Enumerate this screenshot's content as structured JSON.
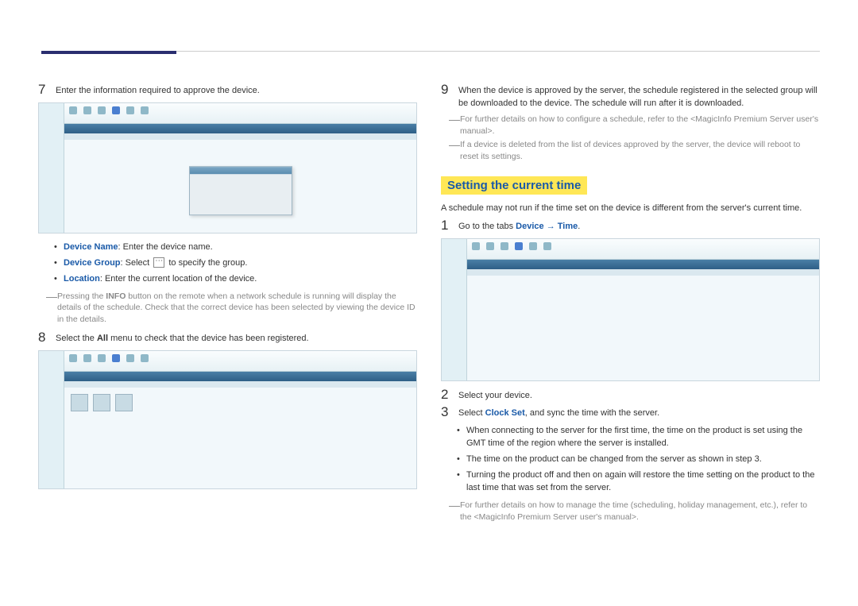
{
  "leftColumn": {
    "step7": {
      "num": "7",
      "text": "Enter the information required to approve the device."
    },
    "bullets7": {
      "deviceNameLabel": "Device Name",
      "deviceNameText": ": Enter the device name.",
      "deviceGroupLabel": "Device Group",
      "deviceGroupPre": ": Select ",
      "deviceGroupPost": " to specify the group.",
      "locationLabel": "Location",
      "locationText": ": Enter the current location of the device."
    },
    "note7": "Pressing the INFO button on the remote when a network schedule is running will display the details of the schedule. Check that the correct device has been selected by viewing the device ID in the details.",
    "note7_boldWord": "INFO",
    "note7_pre": "Pressing the ",
    "note7_post": " button on the remote when a network schedule is running will display the details of the schedule. Check that the correct device has been selected by viewing the device ID in the details.",
    "step8": {
      "num": "8",
      "pre": "Select the ",
      "bold": "All",
      "post": " menu to check that the device has been registered."
    }
  },
  "rightColumn": {
    "step9": {
      "num": "9",
      "text": "When the device is approved by the server, the schedule registered in the selected group will be downloaded to the device. The schedule will run after it is downloaded."
    },
    "note9a": "For further details on how to configure a schedule, refer to the <MagicInfo Premium Server user's manual>.",
    "note9b": "If a device is deleted from the list of devices approved by the server, the device will reboot to reset its settings.",
    "heading": "Setting the current time",
    "headingPara": "A schedule may not run if the time set on the device is different from the server's current time.",
    "step1": {
      "num": "1",
      "pre": "Go to the tabs ",
      "link1": "Device",
      "arrow": " → ",
      "link2": "Time",
      "post": "."
    },
    "step2": {
      "num": "2",
      "text": "Select your device."
    },
    "step3": {
      "num": "3",
      "pre": "Select ",
      "link": "Clock Set",
      "post": ", and sync the time with the server."
    },
    "bullets3": {
      "b1": "When connecting to the server for the first time, the time on the product is set using the GMT time of the region where the server is installed.",
      "b2": "The time on the product can be changed from the server as shown in step 3.",
      "b3": "Turning the product off and then on again will restore the time setting on the product to the last time that was set from the server."
    },
    "noteFinal": "For further details on how to manage the time (scheduling, holiday management, etc.), refer to the <MagicInfo Premium Server user's manual>."
  }
}
